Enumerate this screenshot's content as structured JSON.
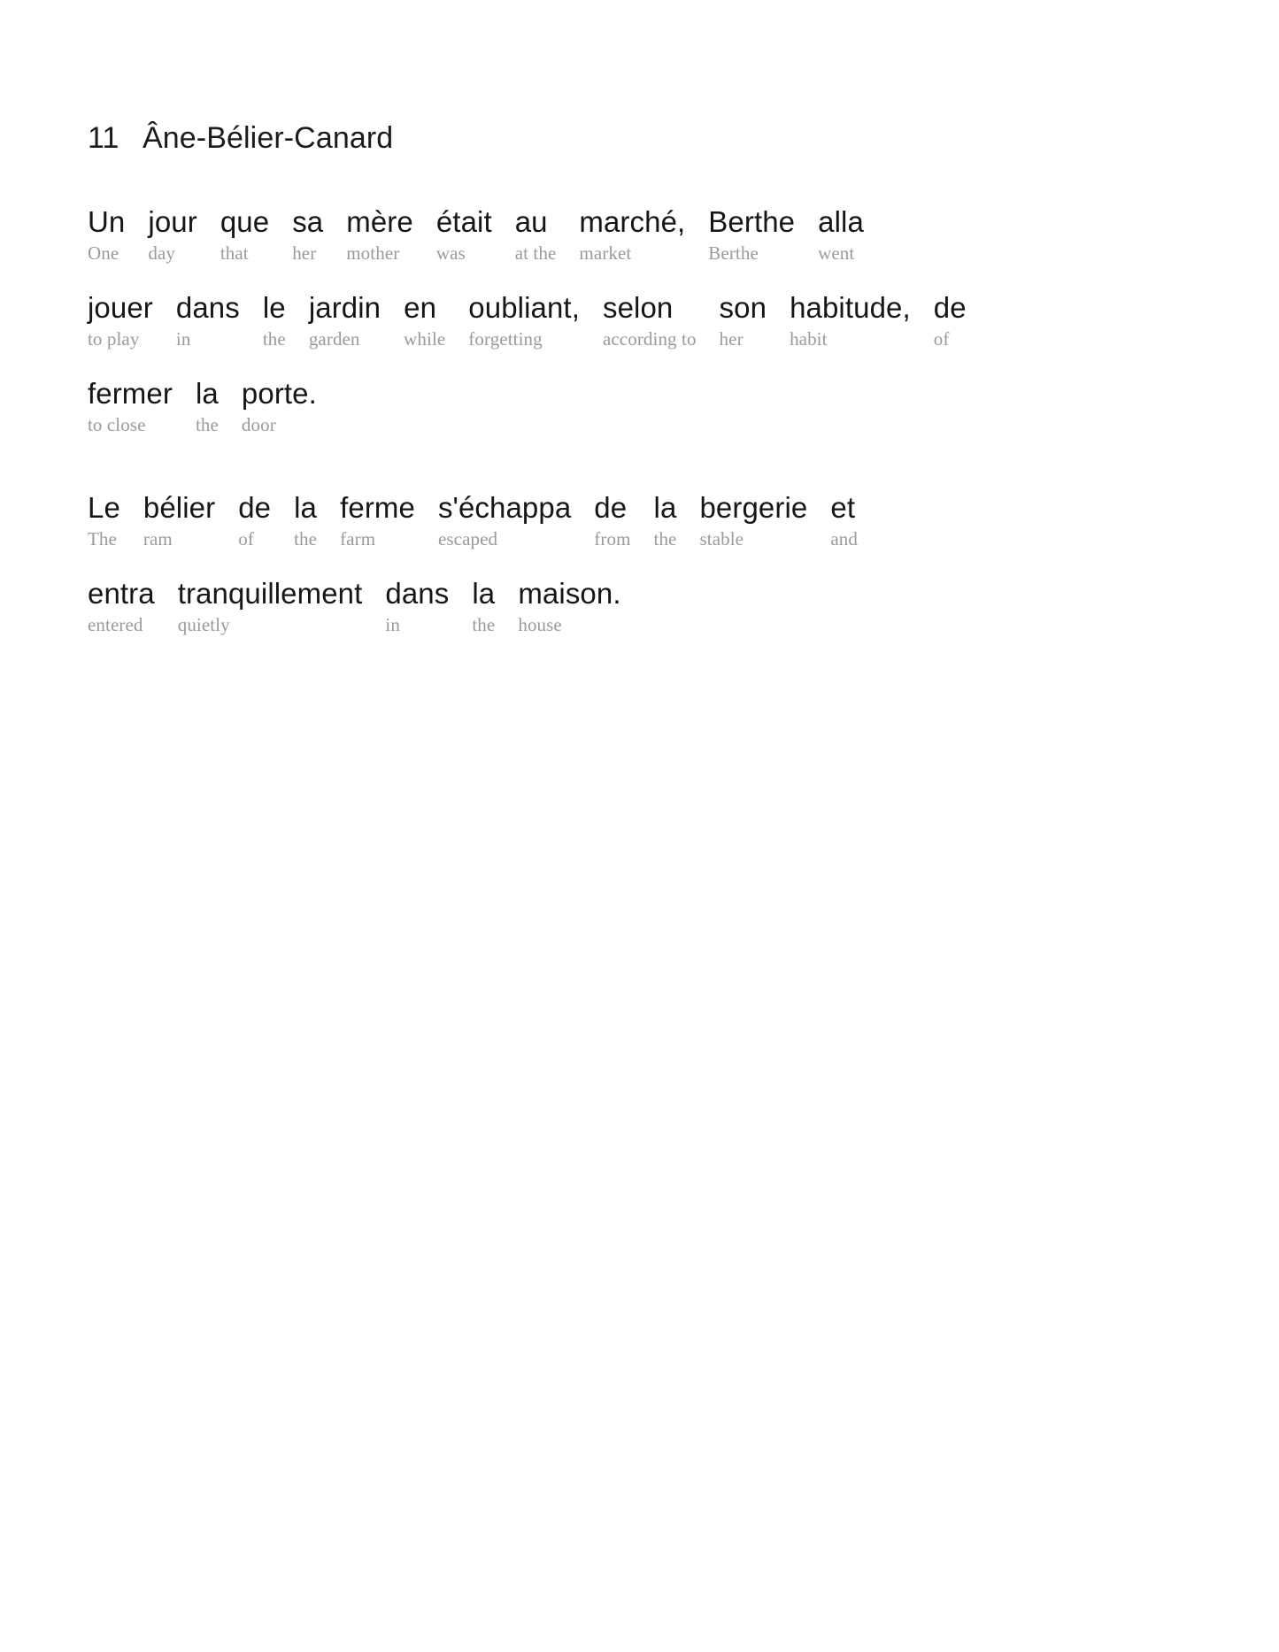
{
  "document": {
    "title_number": "11",
    "title_text": "Âne-Bélier-Canard",
    "source_language": "French",
    "gloss_language": "English",
    "colors": {
      "page_background": "#ffffff",
      "source_text": "#161616",
      "gloss_text": "#9a9a9a",
      "title_text": "#1b1b1b"
    }
  },
  "paragraphs": [
    {
      "index": 0,
      "lines": [
        {
          "index": 0,
          "pairs": [
            {
              "src": "Un",
              "gls": "One"
            },
            {
              "src": "jour",
              "gls": "day"
            },
            {
              "src": "que",
              "gls": "that"
            },
            {
              "src": "sa",
              "gls": "her"
            },
            {
              "src": "mère",
              "gls": "mother"
            },
            {
              "src": "était",
              "gls": "was"
            },
            {
              "src": "au",
              "gls": "at the"
            },
            {
              "src": "marché,",
              "gls": "market"
            },
            {
              "src": "Berthe",
              "gls": "Berthe"
            },
            {
              "src": "alla",
              "gls": "went"
            }
          ]
        },
        {
          "index": 1,
          "pairs": [
            {
              "src": "jouer",
              "gls": "to play"
            },
            {
              "src": "dans",
              "gls": "in"
            },
            {
              "src": "le",
              "gls": "the"
            },
            {
              "src": "jardin",
              "gls": "garden"
            },
            {
              "src": "en",
              "gls": "while"
            },
            {
              "src": "oubliant,",
              "gls": "forgetting"
            },
            {
              "src": "selon",
              "gls": "according to"
            },
            {
              "src": "son",
              "gls": "her"
            },
            {
              "src": "habitude,",
              "gls": "habit"
            },
            {
              "src": "de",
              "gls": "of"
            }
          ]
        },
        {
          "index": 2,
          "pairs": [
            {
              "src": "fermer",
              "gls": "to close"
            },
            {
              "src": "la",
              "gls": "the"
            },
            {
              "src": "porte.",
              "gls": "door"
            }
          ]
        }
      ]
    },
    {
      "index": 1,
      "lines": [
        {
          "index": 0,
          "pairs": [
            {
              "src": "Le",
              "gls": "The"
            },
            {
              "src": "bélier",
              "gls": "ram"
            },
            {
              "src": "de",
              "gls": "of"
            },
            {
              "src": "la",
              "gls": "the"
            },
            {
              "src": "ferme",
              "gls": "farm"
            },
            {
              "src": "s'échappa",
              "gls": "escaped"
            },
            {
              "src": "de",
              "gls": "from"
            },
            {
              "src": "la",
              "gls": "the"
            },
            {
              "src": "bergerie",
              "gls": "stable"
            },
            {
              "src": "et",
              "gls": "and"
            }
          ]
        },
        {
          "index": 1,
          "pairs": [
            {
              "src": "entra",
              "gls": "entered"
            },
            {
              "src": "tranquillement",
              "gls": "quietly"
            },
            {
              "src": "dans",
              "gls": "in"
            },
            {
              "src": "la",
              "gls": "the"
            },
            {
              "src": "maison.",
              "gls": "house"
            }
          ]
        }
      ]
    }
  ]
}
